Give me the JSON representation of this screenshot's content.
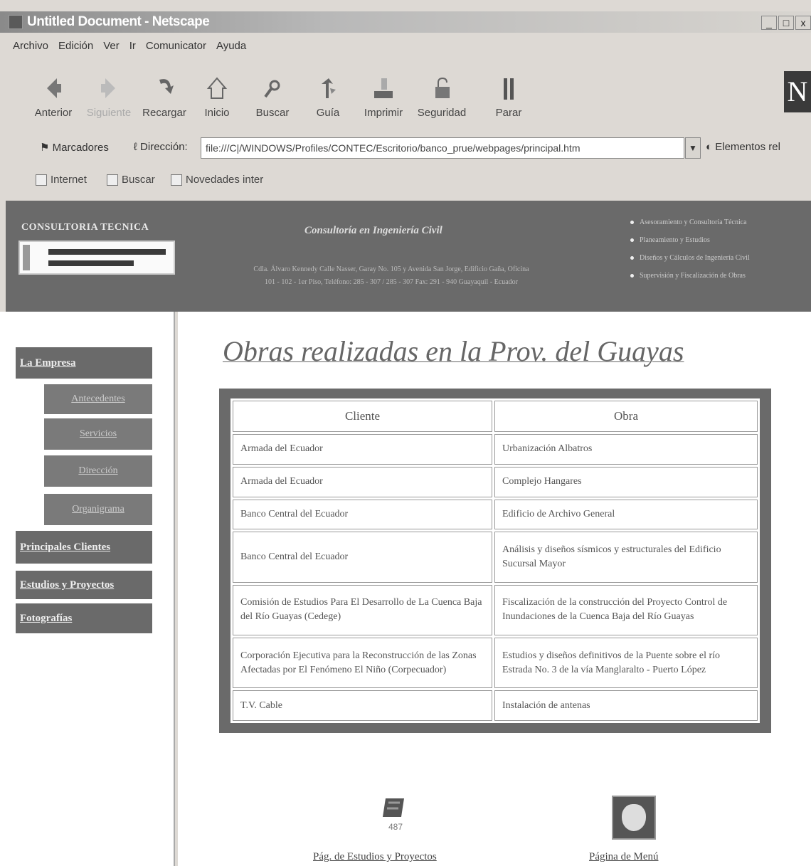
{
  "window": {
    "title": "Untitled Document - Netscape",
    "buttons": [
      "_",
      "□",
      "x"
    ]
  },
  "menu": [
    "Archivo",
    "Edición",
    "Ver",
    "Ir",
    "Comunicator",
    "Ayuda"
  ],
  "toolbar": [
    {
      "label": "Anterior",
      "icon": "back-arrow-icon"
    },
    {
      "label": "Siguiente",
      "icon": "forward-arrow-icon"
    },
    {
      "label": "Recargar",
      "icon": "reload-icon"
    },
    {
      "label": "Inicio",
      "icon": "home-icon"
    },
    {
      "label": "Buscar",
      "icon": "search-icon"
    },
    {
      "label": "Guía",
      "icon": "guide-icon"
    },
    {
      "label": "Imprimir",
      "icon": "print-icon"
    },
    {
      "label": "Seguridad",
      "icon": "lock-icon"
    },
    {
      "label": "Parar",
      "icon": "stop-icon"
    }
  ],
  "location": {
    "bookmarks_label": "Marcadores",
    "address_label": "Dirección:",
    "url": "file:///C|/WINDOWS/Profiles/CONTEC/Escritorio/banco_prue/webpages/principal.htm",
    "related_label": "Elementos rel"
  },
  "personal_toolbar": [
    "Internet",
    "Buscar",
    "Novedades inter"
  ],
  "header": {
    "company": "CONSULTORIA TECNICA",
    "tagline": "Consultoría en Ingeniería Civil",
    "address_line1": "Cdla. Álvaro Kennedy Calle Nasser, Garay No. 105 y Avenida San Jorge, Edificio Gaña, Oficina",
    "address_line2": "101 - 102 - 1er Piso, Teléfono: 285 - 307 / 285 - 307 Fax: 291 - 940 Guayaquil - Ecuador",
    "services": [
      "Asesoramiento y Consultoría Técnica",
      "Planeamiento y Estudios",
      "Diseños y Cálculos de Ingeniería Civil",
      "Supervisión y Fiscalización de Obras"
    ]
  },
  "sidebar": {
    "items": [
      {
        "label": "La Empresa",
        "type": "main"
      },
      {
        "label": "Antecedentes",
        "type": "sub"
      },
      {
        "label": "Servicios",
        "type": "sub"
      },
      {
        "label": "Dirección",
        "type": "sub"
      },
      {
        "label": "Organigrama",
        "type": "sub"
      },
      {
        "label": "Principales Clientes",
        "type": "main"
      },
      {
        "label": "Estudios y Proyectos",
        "type": "main"
      },
      {
        "label": "Fotografías",
        "type": "main"
      }
    ]
  },
  "page": {
    "title": "Obras realizadas en la Prov. del Guayas",
    "table": {
      "headers": [
        "Cliente",
        "Obra"
      ],
      "rows": [
        [
          "Armada del Ecuador",
          "Urbanización Albatros"
        ],
        [
          "Armada del Ecuador",
          "Complejo Hangares"
        ],
        [
          "Banco Central del Ecuador",
          "Edificio de Archivo General"
        ],
        [
          "Banco Central del Ecuador",
          "Análisis y diseños sísmicos y estructurales del Edificio Sucursal Mayor"
        ],
        [
          "Comisión de Estudios Para El Desarrollo de La Cuenca Baja del Río Guayas (Cedege)",
          "Fiscalización de la construcción del Proyecto Control de Inundaciones de la Cuenca Baja del Río Guayas"
        ],
        [
          "Corporación Ejecutiva para la Reconstrucción de las Zonas Afectadas por El Fenómeno El Niño (Corpecuador)",
          "Estudios y diseños definitivos de la Puente sobre el río Estrada No. 3 de la vía Manglaralto - Puerto López"
        ],
        [
          "T.V. Cable",
          "Instalación de antenas"
        ]
      ]
    },
    "footer_links": [
      {
        "label": "Pág. de Estudios y Proyectos",
        "icon": "projects-icon"
      },
      {
        "label": "Página de Menú",
        "icon": "menu-icon"
      }
    ]
  }
}
